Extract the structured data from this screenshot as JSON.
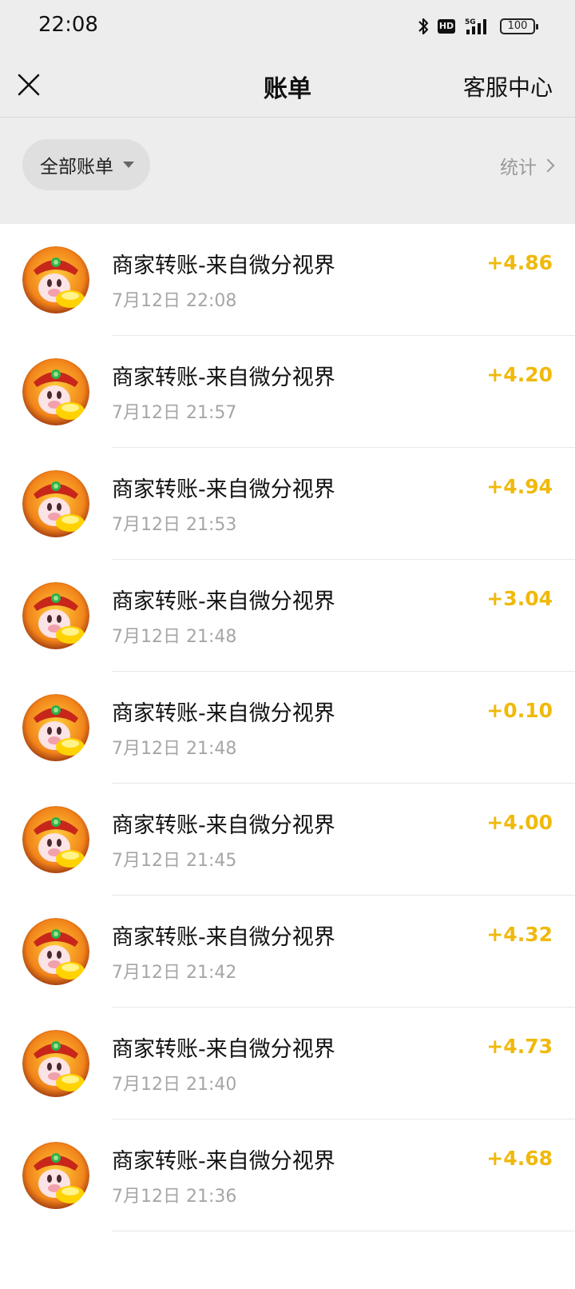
{
  "status_bar": {
    "time": "22:08",
    "battery": "100",
    "hd_badge": "HD",
    "network": "5G"
  },
  "nav": {
    "title": "账单",
    "service": "客服中心",
    "close_icon": "close-icon"
  },
  "filter": {
    "all_bills": "全部账单",
    "stats": "统计"
  },
  "transactions": [
    {
      "title": "商家转账-来自微分视界",
      "time": "7月12日 22:08",
      "amount": "+4.86"
    },
    {
      "title": "商家转账-来自微分视界",
      "time": "7月12日 21:57",
      "amount": "+4.20"
    },
    {
      "title": "商家转账-来自微分视界",
      "time": "7月12日 21:53",
      "amount": "+4.94"
    },
    {
      "title": "商家转账-来自微分视界",
      "time": "7月12日 21:48",
      "amount": "+3.04"
    },
    {
      "title": "商家转账-来自微分视界",
      "time": "7月12日 21:48",
      "amount": "+0.10"
    },
    {
      "title": "商家转账-来自微分视界",
      "time": "7月12日 21:45",
      "amount": "+4.00"
    },
    {
      "title": "商家转账-来自微分视界",
      "time": "7月12日 21:42",
      "amount": "+4.32"
    },
    {
      "title": "商家转账-来自微分视界",
      "time": "7月12日 21:40",
      "amount": "+4.73"
    },
    {
      "title": "商家转账-来自微分视界",
      "time": "7月12日 21:36",
      "amount": "+4.68"
    }
  ],
  "colors": {
    "amount": "#f0b90b",
    "background": "#ededed"
  }
}
